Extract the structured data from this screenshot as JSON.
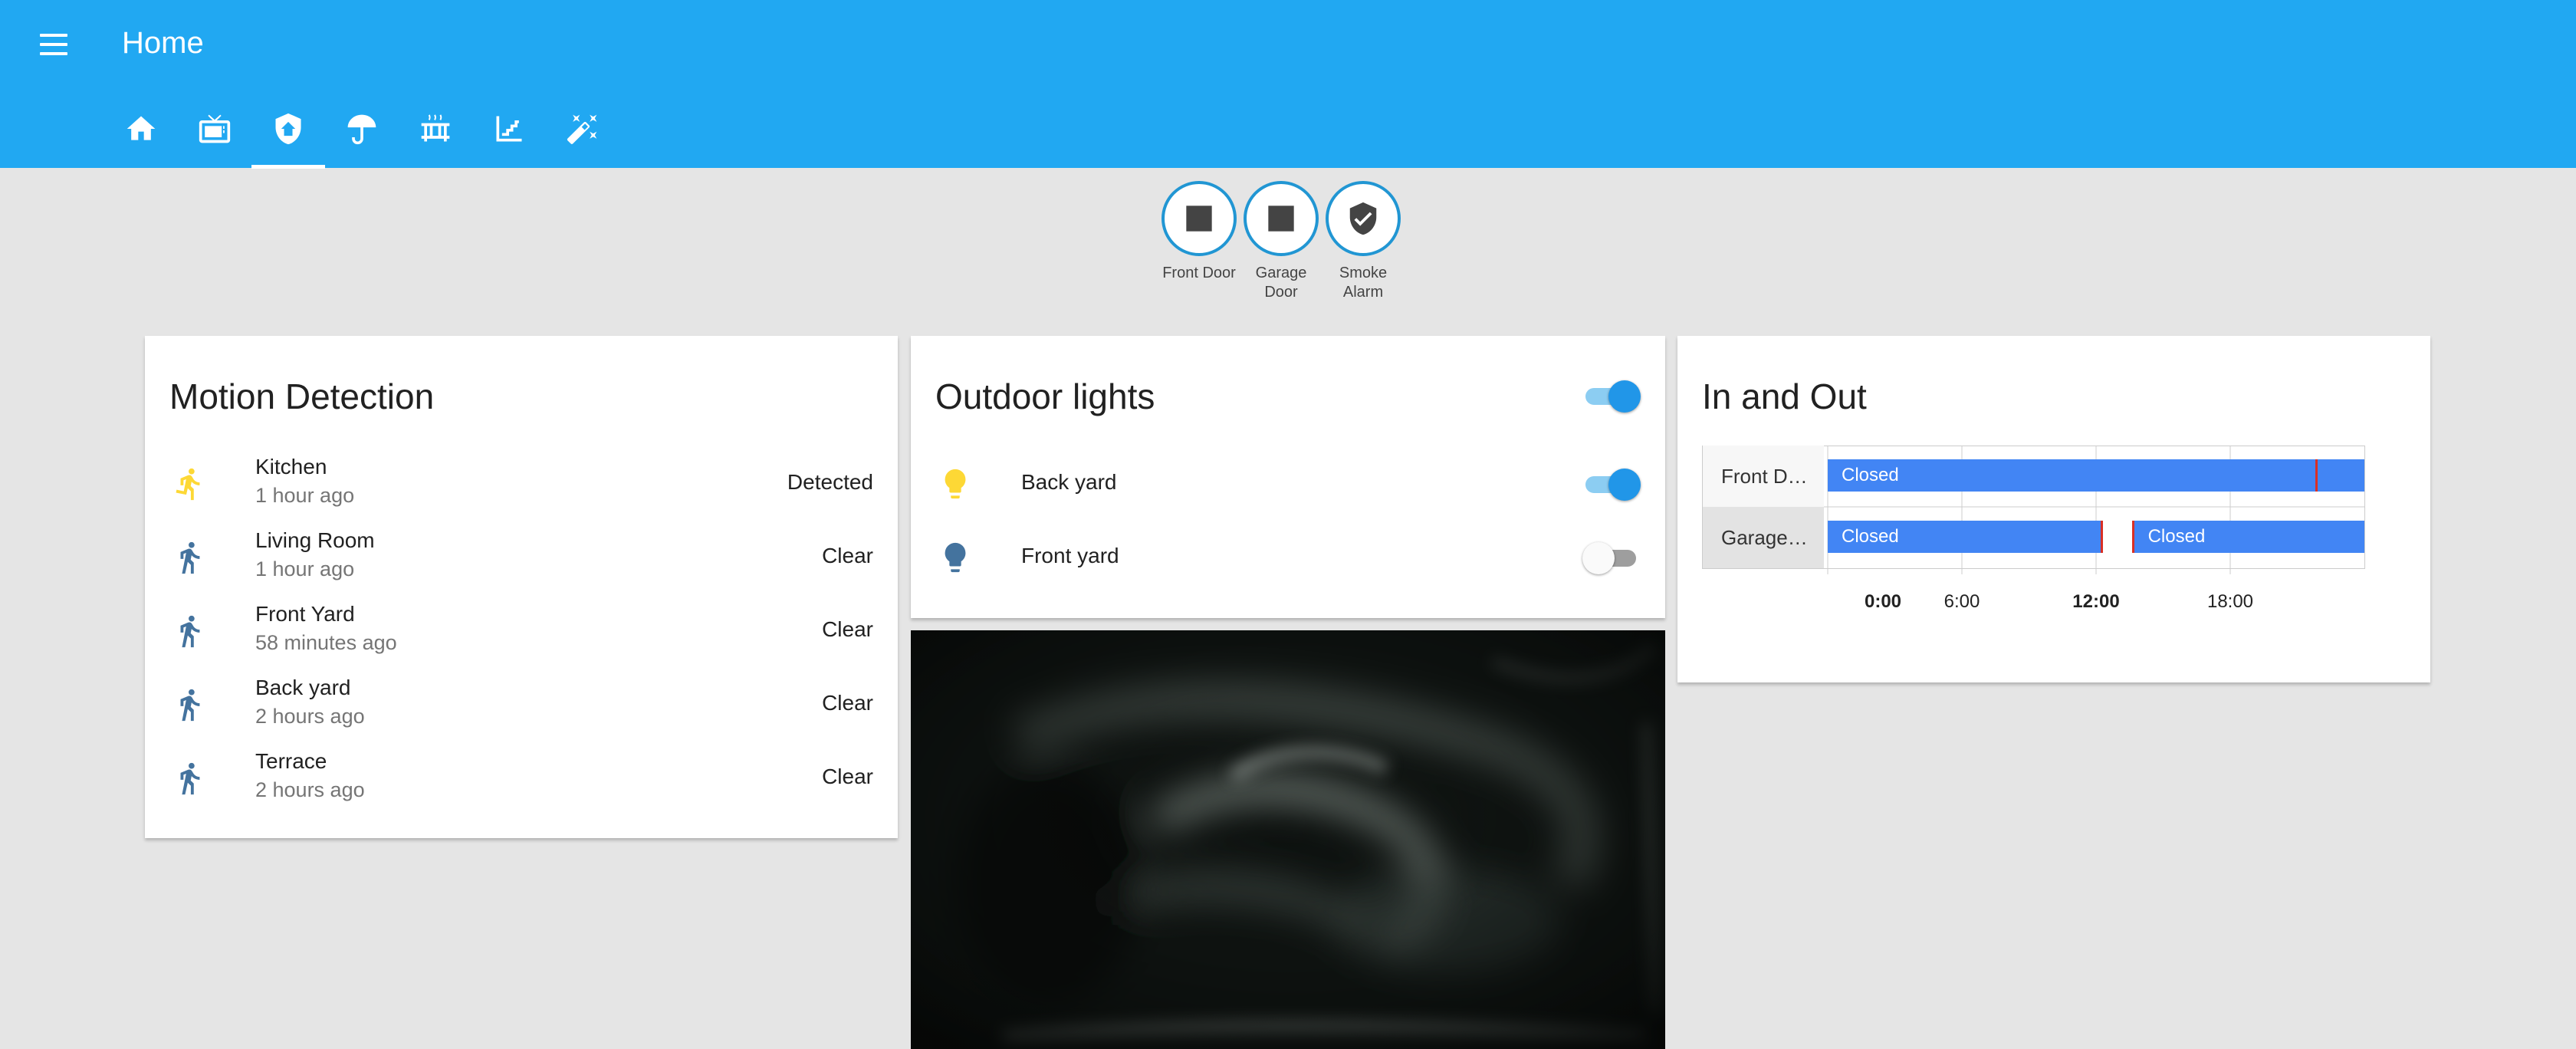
{
  "header": {
    "title": "Home",
    "menu_icon": "hamburger-menu-icon",
    "tabs": [
      {
        "icon": "home-icon",
        "active": false
      },
      {
        "icon": "tv-icon",
        "active": false
      },
      {
        "icon": "home-shield-icon",
        "active": true
      },
      {
        "icon": "umbrella-icon",
        "active": false
      },
      {
        "icon": "radiator-icon",
        "active": false
      },
      {
        "icon": "stairs-icon",
        "active": false
      },
      {
        "icon": "magic-wand-icon",
        "active": false
      }
    ]
  },
  "badges": [
    {
      "label": "Front Door",
      "icon": "stop-square-icon"
    },
    {
      "label": "Garage Door",
      "icon": "stop-square-icon"
    },
    {
      "label": "Smoke Alarm",
      "icon": "shield-check-icon"
    }
  ],
  "motion_card": {
    "title": "Motion Detection",
    "items": [
      {
        "name": "Kitchen",
        "time": "1 hour ago",
        "state": "Detected",
        "icon": "run-icon",
        "icon_color": "#fdd835"
      },
      {
        "name": "Living Room",
        "time": "1 hour ago",
        "state": "Clear",
        "icon": "walk-icon",
        "icon_color": "#44739e"
      },
      {
        "name": "Front Yard",
        "time": "58 minutes ago",
        "state": "Clear",
        "icon": "walk-icon",
        "icon_color": "#44739e"
      },
      {
        "name": "Back yard",
        "time": "2 hours ago",
        "state": "Clear",
        "icon": "walk-icon",
        "icon_color": "#44739e"
      },
      {
        "name": "Terrace",
        "time": "2 hours ago",
        "state": "Clear",
        "icon": "walk-icon",
        "icon_color": "#44739e"
      }
    ]
  },
  "lights_card": {
    "title": "Outdoor lights",
    "master_on": true,
    "items": [
      {
        "name": "Back yard",
        "on": true,
        "icon": "lightbulb-icon",
        "icon_color": "#fdd835"
      },
      {
        "name": "Front yard",
        "on": false,
        "icon": "lightbulb-icon",
        "icon_color": "#44739e"
      }
    ]
  },
  "camera": {
    "icon": "camera-feed-image"
  },
  "history_card": {
    "title": "In and Out",
    "rows": [
      {
        "label": "Front D…",
        "segments": [
          {
            "text": "Closed",
            "from_h": 0,
            "to_h": 24
          }
        ],
        "changes_h": [
          21.8
        ]
      },
      {
        "label": "Garage…",
        "segments": [
          {
            "text": "Closed",
            "from_h": 0,
            "to_h": 12.2
          },
          {
            "text": "Closed",
            "from_h": 13.7,
            "to_h": 24
          }
        ],
        "changes_h": [
          12.2,
          13.6
        ]
      }
    ],
    "ticks": [
      {
        "text": "0:00",
        "h": 0,
        "bold": true
      },
      {
        "text": "6:00",
        "h": 6,
        "bold": false
      },
      {
        "text": "12:00",
        "h": 12,
        "bold": true
      },
      {
        "text": "18:00",
        "h": 18,
        "bold": false
      }
    ],
    "colors": {
      "bar": "#4285f4",
      "change": "#d93025"
    }
  }
}
